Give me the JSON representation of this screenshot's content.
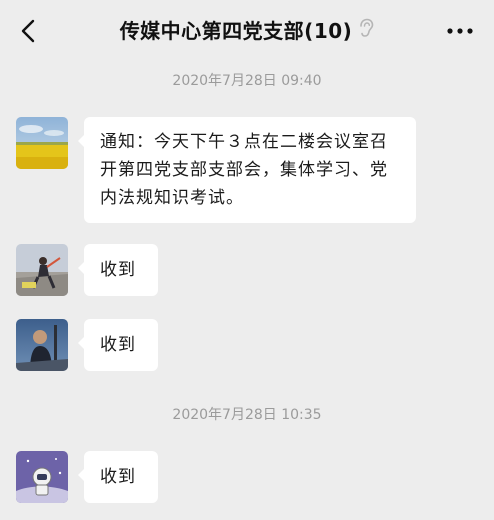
{
  "header": {
    "title": "传媒中心第四党支部(10)",
    "back_icon": "chevron-left-icon",
    "mute_icon": "ear-icon",
    "more_icon": "more-dots-icon"
  },
  "chat": {
    "timestamp_1": "2020年7月28日 09:40",
    "timestamp_2": "2020年7月28日 10:35",
    "messages": [
      {
        "avatar": "rapeseed-field-avatar",
        "text": "通知：今天下午３点在二楼会议室召开第四党支部支部会，集体学习、党内法规知识考试。"
      },
      {
        "avatar": "sports-photo-avatar",
        "text": "收到"
      },
      {
        "avatar": "person-portrait-avatar",
        "text": "收到"
      },
      {
        "avatar": "astronaut-cartoon-avatar",
        "text": "收到"
      }
    ]
  },
  "colors": {
    "background": "#ededed",
    "bubble": "#ffffff",
    "timestamp_text": "#9b9b9b"
  }
}
